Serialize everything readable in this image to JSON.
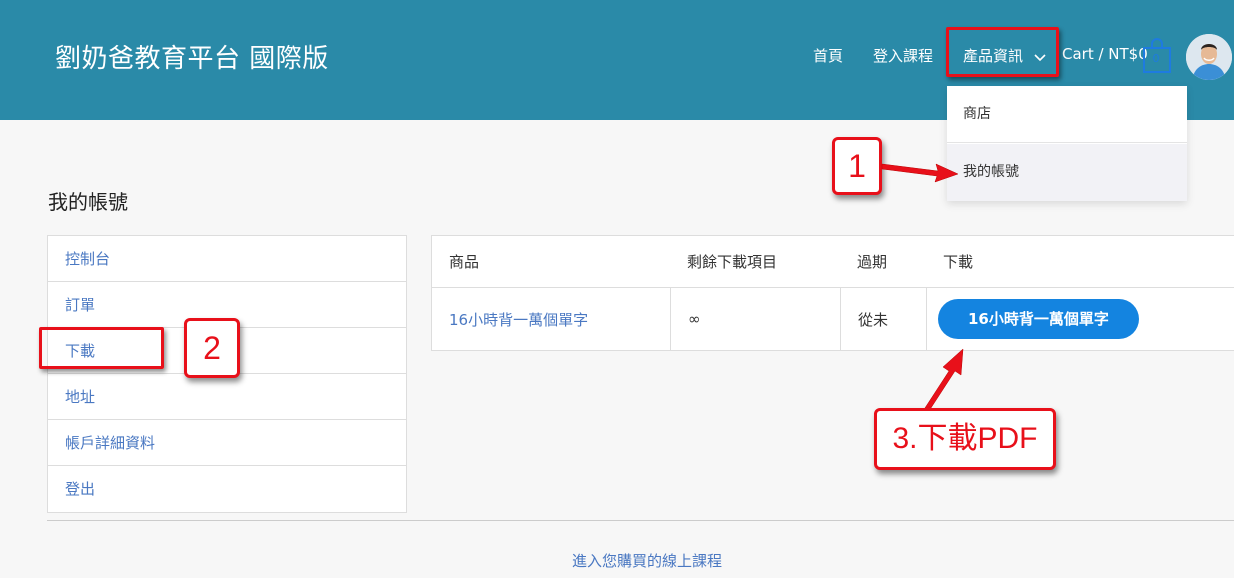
{
  "header": {
    "site_title": "劉奶爸教育平台 國際版",
    "nav": {
      "home": "首頁",
      "login_course": "登入課程",
      "products": "產品資訊"
    },
    "cart_label": "Cart / NT$0",
    "cart_count": "0"
  },
  "dropdown": {
    "items": [
      "商店",
      "我的帳號"
    ]
  },
  "page": {
    "title": "我的帳號"
  },
  "sidebar": {
    "items": [
      "控制台",
      "訂單",
      "下載",
      "地址",
      "帳戶詳細資料",
      "登出"
    ]
  },
  "downloads_table": {
    "headers": [
      "商品",
      "剩餘下載項目",
      "過期",
      "下載"
    ],
    "rows": [
      {
        "product": "16小時背一萬個單字",
        "remaining": "∞",
        "expires": "從未",
        "download_label": "16小時背一萬個單字"
      }
    ]
  },
  "annotations": {
    "step1": "1",
    "step2": "2",
    "step3": "3.下載PDF"
  },
  "footer_link": "進入您購買的線上課程",
  "colors": {
    "header_bg": "#2a8aa8",
    "link": "#4a78c2",
    "button": "#1484e0",
    "annotation_red": "#e8101a"
  }
}
